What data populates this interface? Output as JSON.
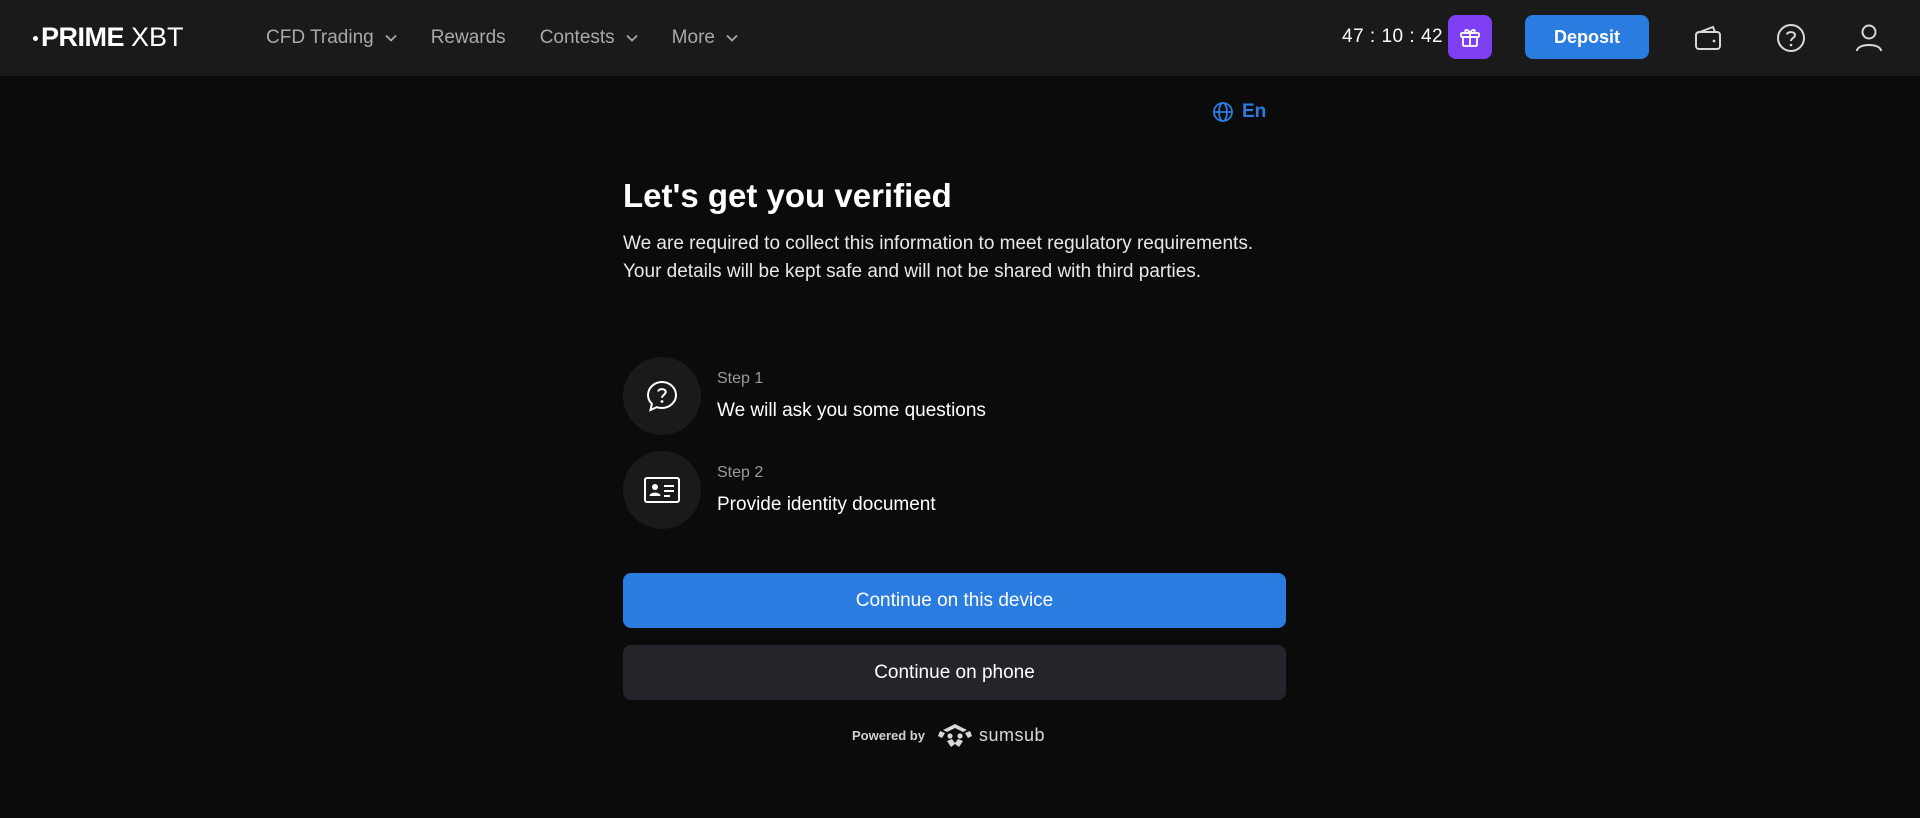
{
  "header": {
    "logo_main": "PRIME",
    "logo_sub": "XBT",
    "nav": [
      {
        "label": "CFD Trading",
        "dropdown": true
      },
      {
        "label": "Rewards",
        "dropdown": false
      },
      {
        "label": "Contests",
        "dropdown": true
      },
      {
        "label": "More",
        "dropdown": true
      }
    ],
    "timer": "47 : 10 : 42",
    "deposit_label": "Deposit",
    "icons": [
      "gift-icon",
      "wallet-icon",
      "help-icon",
      "user-icon"
    ]
  },
  "language": {
    "label": "En",
    "icon": "globe-icon"
  },
  "main": {
    "title": "Let's get you verified",
    "description": "We are required to collect this information to meet regulatory requirements. Your details will be kept safe and will not be shared with third parties.",
    "steps": [
      {
        "number": "Step 1",
        "label": "We will ask you some questions",
        "icon": "question-bubble-icon"
      },
      {
        "number": "Step 2",
        "label": "Provide identity document",
        "icon": "id-card-icon"
      }
    ],
    "continue_device_label": "Continue on this device",
    "continue_phone_label": "Continue on phone",
    "powered_by": "Powered by",
    "powered_brand": "sumsub"
  },
  "colors": {
    "accent": "#2b7ce0",
    "gift": "#7e3ff2",
    "background": "#0b0b0b",
    "header": "#1a1a1a",
    "secondary_button": "#23252b"
  }
}
